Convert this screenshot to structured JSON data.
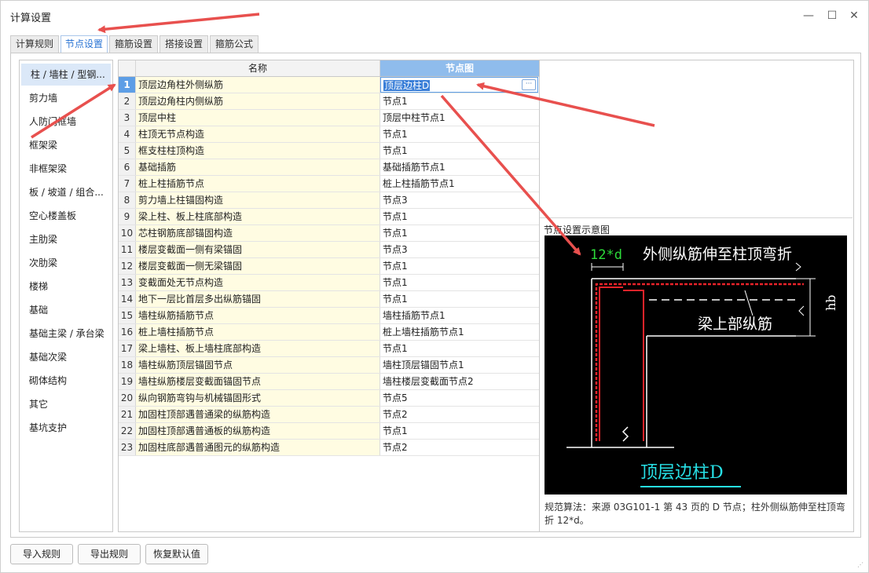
{
  "window": {
    "title": "计算设置"
  },
  "tabs": [
    {
      "label": "计算规则",
      "active": false
    },
    {
      "label": "节点设置",
      "active": true
    },
    {
      "label": "箍筋设置",
      "active": false
    },
    {
      "label": "搭接设置",
      "active": false
    },
    {
      "label": "箍筋公式",
      "active": false
    }
  ],
  "sidebar": {
    "items": [
      {
        "label": "柱 / 墙柱 / 型钢...",
        "active": true
      },
      {
        "label": "剪力墙"
      },
      {
        "label": "人防门框墙"
      },
      {
        "label": "框架梁"
      },
      {
        "label": "非框架梁"
      },
      {
        "label": "板 / 坡道 / 组合..."
      },
      {
        "label": "空心楼盖板"
      },
      {
        "label": "主肋梁"
      },
      {
        "label": "次肋梁"
      },
      {
        "label": "楼梯"
      },
      {
        "label": "基础"
      },
      {
        "label": "基础主梁 / 承台梁"
      },
      {
        "label": "基础次梁"
      },
      {
        "label": "砌体结构"
      },
      {
        "label": "其它"
      },
      {
        "label": "基坑支护"
      }
    ]
  },
  "grid": {
    "columns": {
      "name": "名称",
      "node": "节点图"
    },
    "rows": [
      {
        "num": "1",
        "name": "顶层边角柱外侧纵筋",
        "node": "顶层边柱D"
      },
      {
        "num": "2",
        "name": "顶层边角柱内侧纵筋",
        "node": "节点1"
      },
      {
        "num": "3",
        "name": "顶层中柱",
        "node": "顶层中柱节点1"
      },
      {
        "num": "4",
        "name": "柱顶无节点构造",
        "node": "节点1"
      },
      {
        "num": "5",
        "name": "框支柱柱顶构造",
        "node": "节点1"
      },
      {
        "num": "6",
        "name": "基础插筋",
        "node": "基础插筋节点1"
      },
      {
        "num": "7",
        "name": "桩上柱插筋节点",
        "node": "桩上柱插筋节点1"
      },
      {
        "num": "8",
        "name": "剪力墙上柱锚固构造",
        "node": "节点3"
      },
      {
        "num": "9",
        "name": "梁上柱、板上柱底部构造",
        "node": "节点1"
      },
      {
        "num": "10",
        "name": "芯柱钢筋底部锚固构造",
        "node": "节点1"
      },
      {
        "num": "11",
        "name": "楼层变截面一侧有梁锚固",
        "node": "节点3"
      },
      {
        "num": "12",
        "name": "楼层变截面一侧无梁锚固",
        "node": "节点1"
      },
      {
        "num": "13",
        "name": "变截面处无节点构造",
        "node": "节点1"
      },
      {
        "num": "14",
        "name": "地下一层比首层多出纵筋锚固",
        "node": "节点1"
      },
      {
        "num": "15",
        "name": "墙柱纵筋插筋节点",
        "node": "墙柱插筋节点1"
      },
      {
        "num": "16",
        "name": "桩上墙柱插筋节点",
        "node": "桩上墙柱插筋节点1"
      },
      {
        "num": "17",
        "name": "梁上墙柱、板上墙柱底部构造",
        "node": "节点1"
      },
      {
        "num": "18",
        "name": "墙柱纵筋顶层锚固节点",
        "node": "墙柱顶层锚固节点1"
      },
      {
        "num": "19",
        "name": "墙柱纵筋楼层变截面锚固节点",
        "node": "墙柱楼层变截面节点2"
      },
      {
        "num": "20",
        "name": "纵向钢筋弯钩与机械锚固形式",
        "node": "节点5"
      },
      {
        "num": "21",
        "name": "加固柱顶部遇普通梁的纵筋构造",
        "node": "节点2"
      },
      {
        "num": "22",
        "name": "加固柱顶部遇普通板的纵筋构造",
        "node": "节点1"
      },
      {
        "num": "23",
        "name": "加固柱底部遇普通图元的纵筋构造",
        "node": "节点2"
      }
    ]
  },
  "diagram": {
    "label": "节点设置示意图",
    "dim_text": "12*d",
    "top_text": "外侧纵筋伸至柱顶弯折",
    "beam_text": "梁上部纵筋",
    "hb_text": "hb",
    "caption": "顶层边柱D",
    "colors": {
      "rebar": "#e8232a",
      "dim": "#2ddc3a",
      "caption": "#27e0e6",
      "line": "#ffffff"
    }
  },
  "description": "规范算法：来源 03G101-1 第 43 页的 D 节点；柱外侧纵筋伸至柱顶弯折 12*d。",
  "footer": {
    "import_label": "导入规则",
    "export_label": "导出规则",
    "restore_label": "恢复默认值"
  },
  "window_controls": {
    "minimize": "—",
    "maximize": "☐",
    "close": "✕"
  },
  "ellipsis": "···"
}
